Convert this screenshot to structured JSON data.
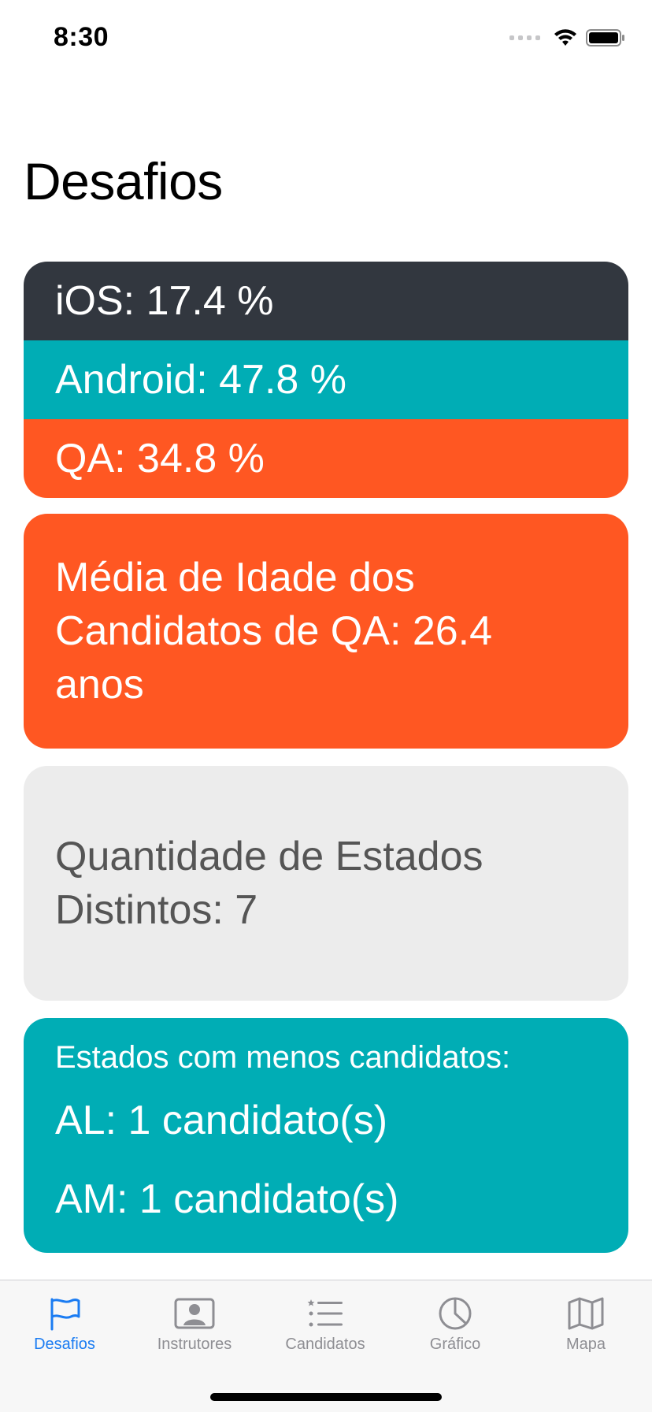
{
  "status_bar": {
    "time": "8:30"
  },
  "page": {
    "title": "Desafios"
  },
  "split_card": {
    "ios": "iOS: 17.4 %",
    "android": "Android: 47.8 %",
    "qa": "QA: 34.8 %"
  },
  "age_card": {
    "text": "Média de Idade dos Candidatos de QA: 26.4 anos"
  },
  "states_card": {
    "text": "Quantidade de Estados Distintos: 7"
  },
  "fewer_card": {
    "title": "Estados com menos candidatos:",
    "items": [
      "AL: 1 candidato(s)",
      "AM: 1 candidato(s)"
    ]
  },
  "tab_bar": {
    "tabs": [
      {
        "label": "Desafios",
        "icon": "flag-icon",
        "active": true
      },
      {
        "label": "Instrutores",
        "icon": "contact-card-icon",
        "active": false
      },
      {
        "label": "Candidatos",
        "icon": "list-icon",
        "active": false
      },
      {
        "label": "Gráfico",
        "icon": "pie-chart-icon",
        "active": false
      },
      {
        "label": "Mapa",
        "icon": "map-icon",
        "active": false
      }
    ]
  },
  "colors": {
    "ios": "#32373f",
    "android": "#00adb5",
    "qa": "#ff5722",
    "neutral_card": "#ececec",
    "tab_active": "#1b7cf2",
    "tab_inactive": "#8e8e93"
  }
}
